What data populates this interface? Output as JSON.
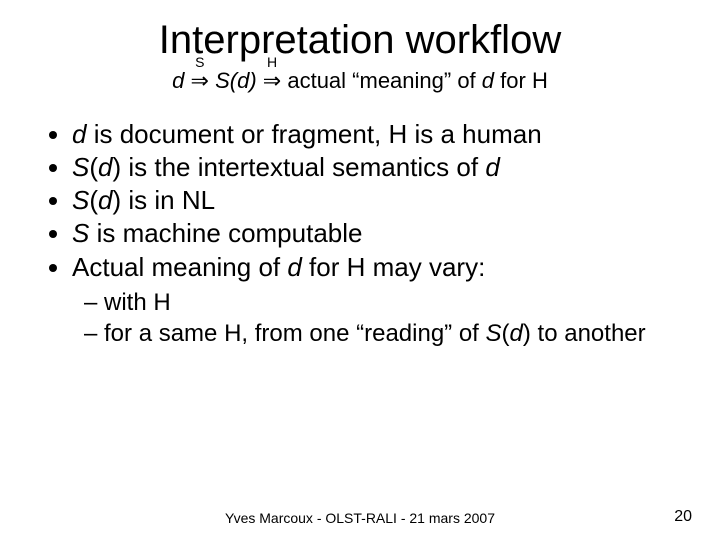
{
  "title": "Interpretation workflow",
  "formula": {
    "d": "d",
    "label1": "S",
    "sd": "S(d)",
    "label2": "H",
    "rest": " actual “meaning” of ",
    "d2": "d",
    "tail": " for H"
  },
  "bullets": {
    "b1a": "d",
    "b1b": " is document or fragment, H is a human",
    "b2a": "S",
    "b2b": "(",
    "b2c": "d",
    "b2d": ") is the intertextual semantics of ",
    "b2e": "d",
    "b3a": "S",
    "b3b": "(",
    "b3c": "d",
    "b3d": ") is in NL",
    "b4a": "S",
    "b4b": " is machine computable",
    "b5a": "Actual meaning of ",
    "b5b": "d",
    "b5c": " for H may vary:"
  },
  "sub": {
    "s1": "– with H",
    "s2a": "– for a same H, from one “reading” of ",
    "s2b": "S",
    "s2c": "(",
    "s2d": "d",
    "s2e": ") to another"
  },
  "footer": "Yves Marcoux - OLST-RALI - 21 mars 2007",
  "page": "20"
}
